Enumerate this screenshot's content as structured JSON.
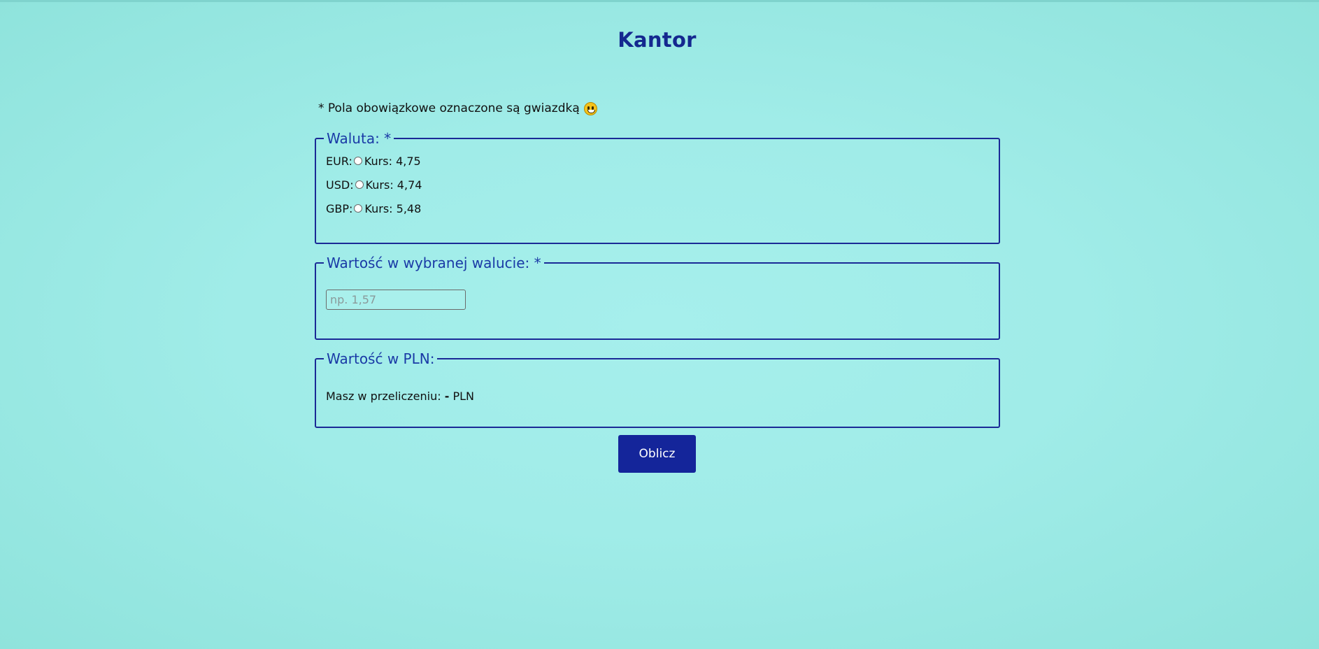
{
  "title": "Kantor",
  "note": {
    "text": "* Pola obowiązkowe oznaczone są gwiazdką",
    "emoji": "grinning-face-emoji"
  },
  "currency_section": {
    "legend": "Waluta: *",
    "options": [
      {
        "code": "EUR:",
        "rate": "Kurs: 4,75"
      },
      {
        "code": "USD:",
        "rate": "Kurs: 4,74"
      },
      {
        "code": "GBP:",
        "rate": "Kurs: 5,48"
      }
    ]
  },
  "amount_section": {
    "legend": "Wartość w wybranej walucie: *",
    "placeholder": "np. 1,57",
    "value": ""
  },
  "pln_section": {
    "legend": "Wartość w PLN:",
    "label": "Masz w przeliczeniu:",
    "result": "-",
    "unit": "PLN"
  },
  "submit_label": "Oblicz",
  "colors": {
    "accent": "#14259a",
    "title": "#14288f",
    "background": "#a0ece8"
  }
}
